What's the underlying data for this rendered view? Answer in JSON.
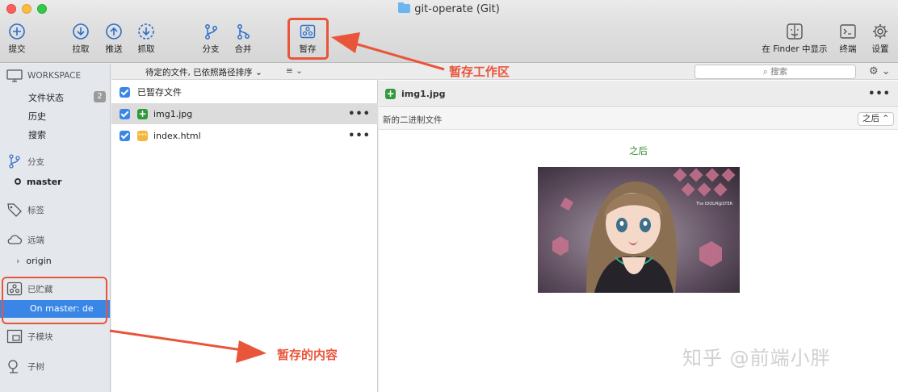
{
  "window": {
    "title": "git-operate (Git)"
  },
  "toolbar": {
    "commit": "提交",
    "pull": "拉取",
    "push": "推送",
    "fetch": "抓取",
    "branch": "分支",
    "merge": "合并",
    "stash": "暂存",
    "show_in_finder": "在 Finder 中显示",
    "terminal": "终端",
    "settings": "设置"
  },
  "sidebar": {
    "workspace": "WORKSPACE",
    "file_status": "文件状态",
    "file_status_count": "2",
    "history": "历史",
    "search": "搜索",
    "branches": "分支",
    "current_branch": "master",
    "tags": "标签",
    "remotes": "远端",
    "remote_origin": "origin",
    "stashes": "已贮藏",
    "stash_item": "On master: de",
    "submodules": "子模块",
    "subtrees": "子树"
  },
  "filelist": {
    "sort_label": "待定的文件, 已依照路径排序 ⌄",
    "staged_header": "已暂存文件",
    "files": [
      {
        "name": "img1.jpg",
        "status": "added",
        "selected": true
      },
      {
        "name": "index.html",
        "status": "modified",
        "selected": false
      }
    ]
  },
  "diff": {
    "search_placeholder": "搜索",
    "file_name": "img1.jpg",
    "binary_label": "新的二进制文件",
    "after_select": "之后",
    "after_label": "之后",
    "image_caption": "The IDOLM@STER"
  },
  "annotations": {
    "stash_workspace": "暂存工作区",
    "stash_content": "暂存的内容",
    "watermark": "知乎 @前端小胖"
  },
  "colors": {
    "accent": "#3a86e6",
    "annotation": "#e9553a",
    "added": "#2f9a3b",
    "modified": "#f4b63e"
  }
}
